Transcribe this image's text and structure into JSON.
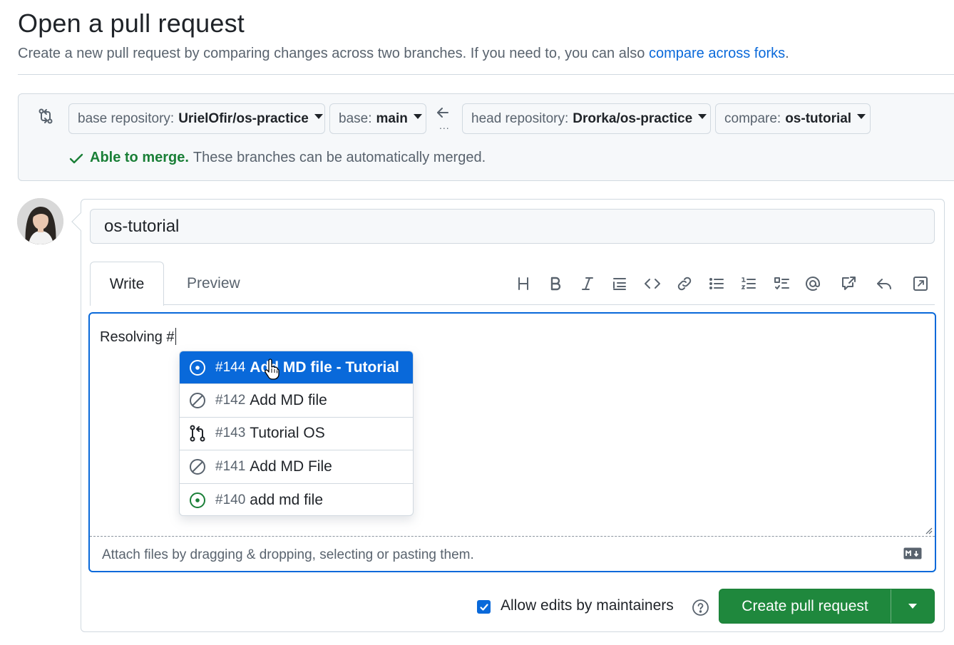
{
  "header": {
    "title": "Open a pull request",
    "subtitle": "Create a new pull request by comparing changes across two branches. If you need to, you can also",
    "forks_link": "compare across forks",
    "forks_tail": "."
  },
  "compare": {
    "base_repo_label": "base repository:",
    "base_repo_value": "UrielOfir/os-practice",
    "base_label": "base:",
    "base_value": "main",
    "ellipsis": "...",
    "head_repo_label": "head repository:",
    "head_repo_value": "Drorka/os-practice",
    "compare_label": "compare:",
    "compare_value": "os-tutorial",
    "merge_status": "Able to merge.",
    "merge_message": "These branches can be automatically merged."
  },
  "form": {
    "title_value": "os-tutorial",
    "tabs": [
      {
        "label": "Write",
        "active": true
      },
      {
        "label": "Preview",
        "active": false
      }
    ],
    "toolbar": [
      "heading-icon",
      "bold-icon",
      "italic-icon",
      "quote-icon",
      "code-icon",
      "link-icon",
      "unordered-list-icon",
      "ordered-list-icon",
      "task-list-icon",
      "mention-icon",
      "cross-reference-icon",
      "reply-icon",
      "fullscreen-icon"
    ],
    "body_text": "Resolving #",
    "attach_hint": "Attach files by dragging & dropping, selecting or pasting them."
  },
  "suggestions": [
    {
      "number": "#144",
      "title": "Add MD file - Tutorial",
      "icon": "issue-open-icon",
      "active": true
    },
    {
      "number": "#142",
      "title": "Add MD file",
      "icon": "issue-closed-not-planned-icon",
      "active": false
    },
    {
      "number": "#143",
      "title": "Tutorial OS",
      "icon": "pull-request-icon",
      "active": false
    },
    {
      "number": "#141",
      "title": "Add MD File",
      "icon": "issue-closed-not-planned-icon",
      "active": false
    },
    {
      "number": "#140",
      "title": "add md file",
      "icon": "issue-open-icon",
      "active": false
    }
  ],
  "footer": {
    "allow_edits_label": "Allow edits by maintainers",
    "allow_edits_checked": true,
    "create_button": "Create pull request"
  },
  "colors": {
    "accent": "#0969da",
    "success": "#1a7f37",
    "button_green": "#1f883d",
    "muted": "#59636e",
    "border": "#d1d9e0"
  }
}
